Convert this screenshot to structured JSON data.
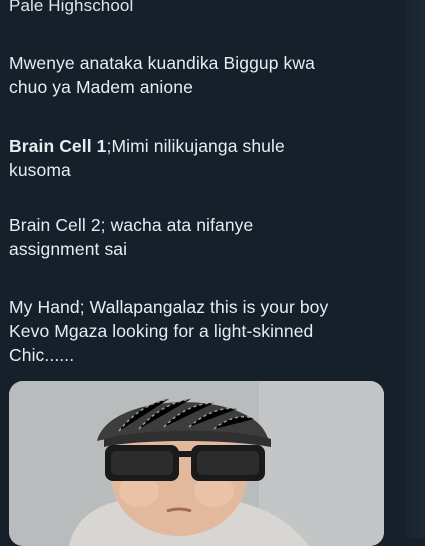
{
  "tweet": {
    "header_text": "Pale Highschool",
    "paragraphs": [
      {
        "plain": "Mwenye anataka kuandika Biggup kwa\nchuo ya Madem anione"
      },
      {
        "bold_prefix": "Brain Cell 1",
        "rest": ";Mimi nilikujanga shule\nkusoma"
      },
      {
        "plain": "Brain Cell 2; wacha ata nifanye\nassignment sai"
      },
      {
        "plain": "My Hand; Wallapangalaz this is your boy\nKevo Mgaza looking for a light-skinned\nChic......"
      }
    ],
    "media": {
      "icon": "baby-in-cap-and-sunglasses-photo"
    }
  },
  "colors": {
    "background": "#15202b",
    "text": "#e7ecef"
  }
}
